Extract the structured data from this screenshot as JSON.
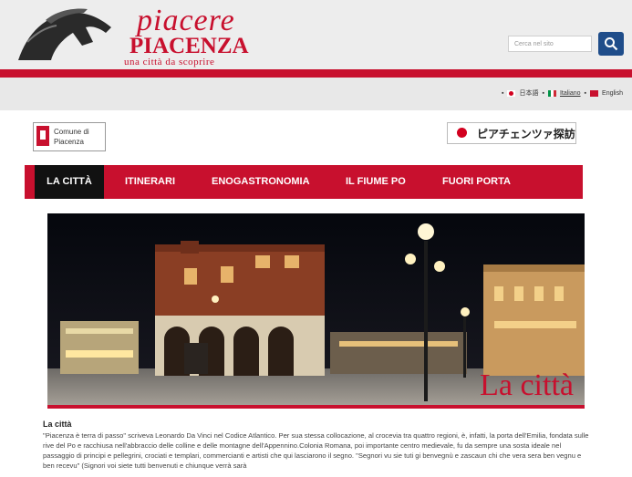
{
  "header": {
    "logo_script": "piacere",
    "logo_main": "PIACENZA",
    "logo_sub": "una città da scoprire",
    "search_placeholder": "Cerca nel sito"
  },
  "languages": [
    {
      "label": "日本語",
      "underlined": false
    },
    {
      "label": "Italiano",
      "underlined": true
    },
    {
      "label": "English",
      "underlined": false
    }
  ],
  "comune": {
    "line1": "Comune di",
    "line2": "Piacenza"
  },
  "jp_banner": {
    "text": "ピアチェンツァ探訪"
  },
  "nav": [
    {
      "label": "LA CITTÀ",
      "active": true
    },
    {
      "label": "ITINERARI",
      "active": false
    },
    {
      "label": "ENOGASTRONOMIA",
      "active": false
    },
    {
      "label": "IL FIUME PO",
      "active": false
    },
    {
      "label": "FUORI PORTA",
      "active": false
    }
  ],
  "hero": {
    "label": "La città"
  },
  "article": {
    "title": "La città",
    "paragraph": "\"Piacenza è terra di passo\" scriveva Leonardo Da Vinci nel Codice Atlantico. Per sua stessa collocazione, al crocevia tra quattro regioni, è, infatti, la porta dell'Emilia, fondata sulle rive del Po e racchiusa nell'abbraccio delle colline e delle montagne dell'Appennino.Colonia Romana, poi importante centro medievale, fu da sempre una sosta ideale nel passaggio di principi e pellegrini, crociati e templari, commercianti e artisti che qui lasciarono il segno. \"Segnori vu sie tuti gi benvegnù e zascaun chi che vera sera ben vegnu e ben recevu\" (Signori voi siete tutti benvenuti e chiunque verrà sarà"
  },
  "colors": {
    "brand_red": "#c8102e",
    "search_blue": "#1f4d8a",
    "nav_active": "#111111"
  }
}
